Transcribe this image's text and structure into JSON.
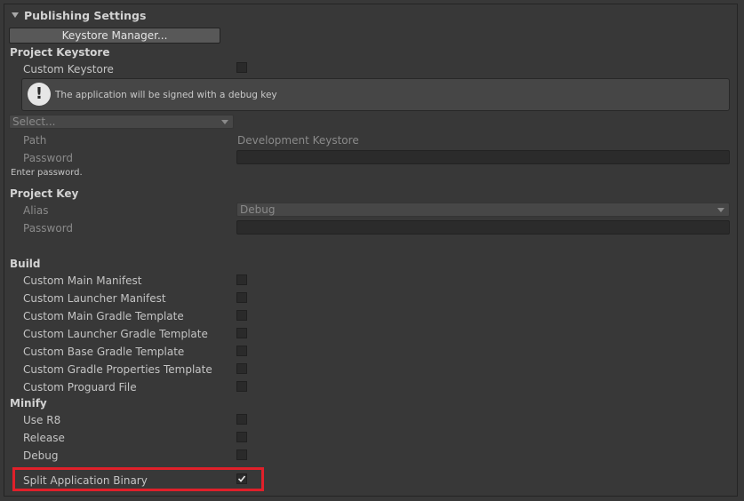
{
  "section": {
    "title": "Publishing Settings"
  },
  "keystore_manager_button": "Keystore Manager...",
  "project_keystore": {
    "heading": "Project Keystore",
    "custom_keystore_label": "Custom Keystore",
    "custom_keystore_checked": false,
    "help_text": "The application will be signed with a debug key",
    "select_placeholder": "Select...",
    "path_label": "Path",
    "path_value": "Development Keystore",
    "password_label": "Password",
    "password_hint": "Enter password."
  },
  "project_key": {
    "heading": "Project Key",
    "alias_label": "Alias",
    "alias_value": "Debug",
    "password_label": "Password"
  },
  "build": {
    "heading": "Build",
    "items": [
      {
        "label": "Custom Main Manifest",
        "checked": false
      },
      {
        "label": "Custom Launcher Manifest",
        "checked": false
      },
      {
        "label": "Custom Main Gradle Template",
        "checked": false
      },
      {
        "label": "Custom Launcher Gradle Template",
        "checked": false
      },
      {
        "label": "Custom Base Gradle Template",
        "checked": false
      },
      {
        "label": "Custom Gradle Properties Template",
        "checked": false
      },
      {
        "label": "Custom Proguard File",
        "checked": false
      }
    ]
  },
  "minify": {
    "heading": "Minify",
    "items": [
      {
        "label": "Use R8",
        "checked": false
      },
      {
        "label": "Release",
        "checked": false
      },
      {
        "label": "Debug",
        "checked": false
      }
    ]
  },
  "split_binary": {
    "label": "Split Application Binary",
    "checked": true
  },
  "colors": {
    "highlight": "#e0202a",
    "panel": "#383838"
  },
  "icons": {
    "foldout": "triangle-down-icon",
    "warning": "exclamation-icon",
    "check": "checkmark-icon"
  }
}
